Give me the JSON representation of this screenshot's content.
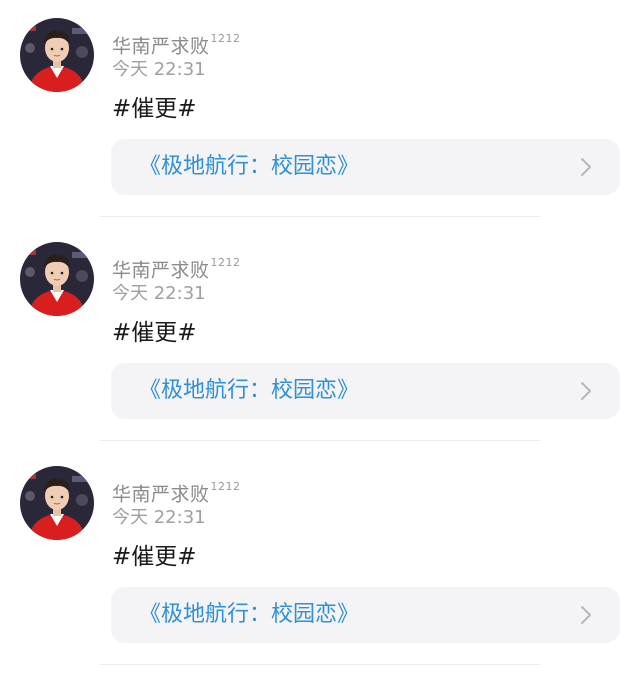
{
  "posts": [
    {
      "username": "华南严求败",
      "badge": "1212",
      "timestamp": "今天 22:31",
      "content": "#催更#",
      "topic": "《极地航行：校园恋》",
      "chevron_icon": "chevron-right-icon"
    },
    {
      "username": "华南严求败",
      "badge": "1212",
      "timestamp": "今天 22:31",
      "content": "#催更#",
      "topic": "《极地航行：校园恋》",
      "chevron_icon": "chevron-right-icon"
    },
    {
      "username": "华南严求败",
      "badge": "1212",
      "timestamp": "今天 22:31",
      "content": "#催更#",
      "topic": "《极地航行：校园恋》",
      "chevron_icon": "chevron-right-icon"
    }
  ],
  "colors": {
    "topic_link": "#2f8fd8",
    "card_bg": "#f4f4f6",
    "username": "#8a8a8a",
    "timestamp": "#a0a0a0",
    "avatar_jacket": "#d81e1e"
  }
}
